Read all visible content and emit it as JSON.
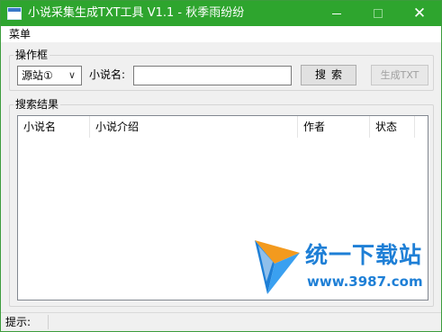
{
  "window": {
    "title": "小说采集生成TXT工具 V1.1 - 秋季雨纷纷",
    "close_glyph": "✕"
  },
  "menu": {
    "items": [
      {
        "label": "菜单"
      }
    ]
  },
  "operations": {
    "group_title": "操作框",
    "source_select": {
      "value": "源站①",
      "options": [
        "源站①"
      ]
    },
    "novel_label": "小说名:",
    "novel_input": {
      "value": "",
      "placeholder": ""
    },
    "search_button": "搜索",
    "generate_button": "生成TXT"
  },
  "results": {
    "group_title": "搜索结果",
    "columns": [
      "小说名",
      "小说介绍",
      "作者",
      "状态"
    ],
    "rows": []
  },
  "watermark": {
    "title": "统一下载站",
    "url": "www.3987.com"
  },
  "status": {
    "label": "提示:"
  },
  "colors": {
    "titlebar": "#2ea52e",
    "watermark": "#1e7fd6"
  },
  "icons": [
    "app-icon",
    "minimize-icon",
    "maximize-icon",
    "close-icon",
    "chevron-down-icon",
    "watermark-logo-icon"
  ]
}
